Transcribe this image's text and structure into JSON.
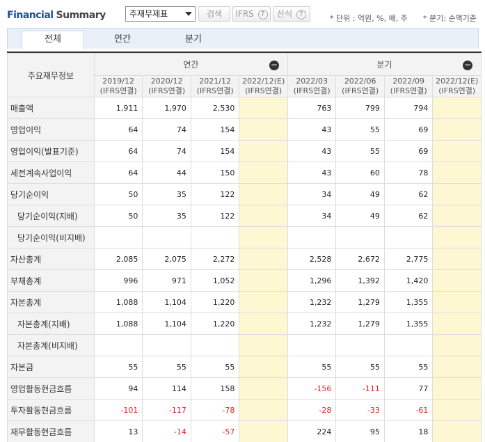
{
  "header": {
    "title_part1": "Financial",
    "title_part2": "Summary",
    "statement_select": "주재무제표",
    "search_label": "검색",
    "ifrs_label": "IFRS",
    "formula_label": "산식",
    "help_glyph": "?",
    "unit_note": "* 단위 : 억원, %, 배, 주",
    "quarter_note": "* 분기: 순액기준"
  },
  "tabs": [
    {
      "label": "전체",
      "active": true
    },
    {
      "label": "연간",
      "active": false
    },
    {
      "label": "분기",
      "active": false
    }
  ],
  "table": {
    "row_header": "주요재무정보",
    "group_annual": "연간",
    "group_quarter": "분기",
    "collapse_glyph": "−",
    "periods": [
      {
        "date": "2019/12",
        "basis": "(IFRS연결)"
      },
      {
        "date": "2020/12",
        "basis": "(IFRS연결)"
      },
      {
        "date": "2021/12",
        "basis": "(IFRS연결)"
      },
      {
        "date": "2022/12(E)",
        "basis": "(IFRS연결)"
      },
      {
        "date": "2022/03",
        "basis": "(IFRS연결)"
      },
      {
        "date": "2022/06",
        "basis": "(IFRS연결)"
      },
      {
        "date": "2022/09",
        "basis": "(IFRS연결)"
      },
      {
        "date": "2022/12(E)",
        "basis": "(IFRS연결)"
      }
    ],
    "rows": [
      {
        "label": "매출액",
        "sub": false,
        "values": [
          "1,911",
          "1,970",
          "2,530",
          "",
          "763",
          "799",
          "794",
          ""
        ]
      },
      {
        "label": "영업이익",
        "sub": false,
        "values": [
          "64",
          "74",
          "154",
          "",
          "43",
          "55",
          "69",
          ""
        ]
      },
      {
        "label": "영업이익(발표기준)",
        "sub": false,
        "values": [
          "64",
          "74",
          "154",
          "",
          "43",
          "55",
          "69",
          ""
        ]
      },
      {
        "label": "세전계속사업이익",
        "sub": false,
        "values": [
          "64",
          "44",
          "150",
          "",
          "43",
          "60",
          "78",
          ""
        ]
      },
      {
        "label": "당기순이익",
        "sub": false,
        "values": [
          "50",
          "35",
          "122",
          "",
          "34",
          "49",
          "62",
          ""
        ]
      },
      {
        "label": "당기순이익(지배)",
        "sub": true,
        "values": [
          "50",
          "35",
          "122",
          "",
          "34",
          "49",
          "62",
          ""
        ]
      },
      {
        "label": "당기순이익(비지배)",
        "sub": true,
        "values": [
          "",
          "",
          "",
          "",
          "",
          "",
          "",
          ""
        ]
      },
      {
        "label": "자산총계",
        "sub": false,
        "values": [
          "2,085",
          "2,075",
          "2,272",
          "",
          "2,528",
          "2,672",
          "2,775",
          ""
        ]
      },
      {
        "label": "부채총계",
        "sub": false,
        "values": [
          "996",
          "971",
          "1,052",
          "",
          "1,296",
          "1,392",
          "1,420",
          ""
        ]
      },
      {
        "label": "자본총계",
        "sub": false,
        "values": [
          "1,088",
          "1,104",
          "1,220",
          "",
          "1,232",
          "1,279",
          "1,355",
          ""
        ]
      },
      {
        "label": "자본총계(지배)",
        "sub": true,
        "values": [
          "1,088",
          "1,104",
          "1,220",
          "",
          "1,232",
          "1,279",
          "1,355",
          ""
        ]
      },
      {
        "label": "자본총계(비지배)",
        "sub": true,
        "values": [
          "",
          "",
          "",
          "",
          "",
          "",
          "",
          ""
        ]
      },
      {
        "label": "자본금",
        "sub": false,
        "values": [
          "55",
          "55",
          "55",
          "",
          "55",
          "55",
          "55",
          ""
        ]
      },
      {
        "label": "영업활동현금흐름",
        "sub": false,
        "values": [
          "94",
          "114",
          "158",
          "",
          "-156",
          "-111",
          "77",
          ""
        ]
      },
      {
        "label": "투자활동현금흐름",
        "sub": false,
        "values": [
          "-101",
          "-117",
          "-78",
          "",
          "-28",
          "-33",
          "-61",
          ""
        ]
      },
      {
        "label": "재무활동현금흐름",
        "sub": false,
        "values": [
          "13",
          "-14",
          "-57",
          "",
          "224",
          "95",
          "18",
          ""
        ]
      }
    ]
  },
  "colors": {
    "title_blue": "#1f4e9a",
    "estimate_bg": "#fdf7d2",
    "negative": "#e02020",
    "header_bg": "#f3f3f3"
  }
}
